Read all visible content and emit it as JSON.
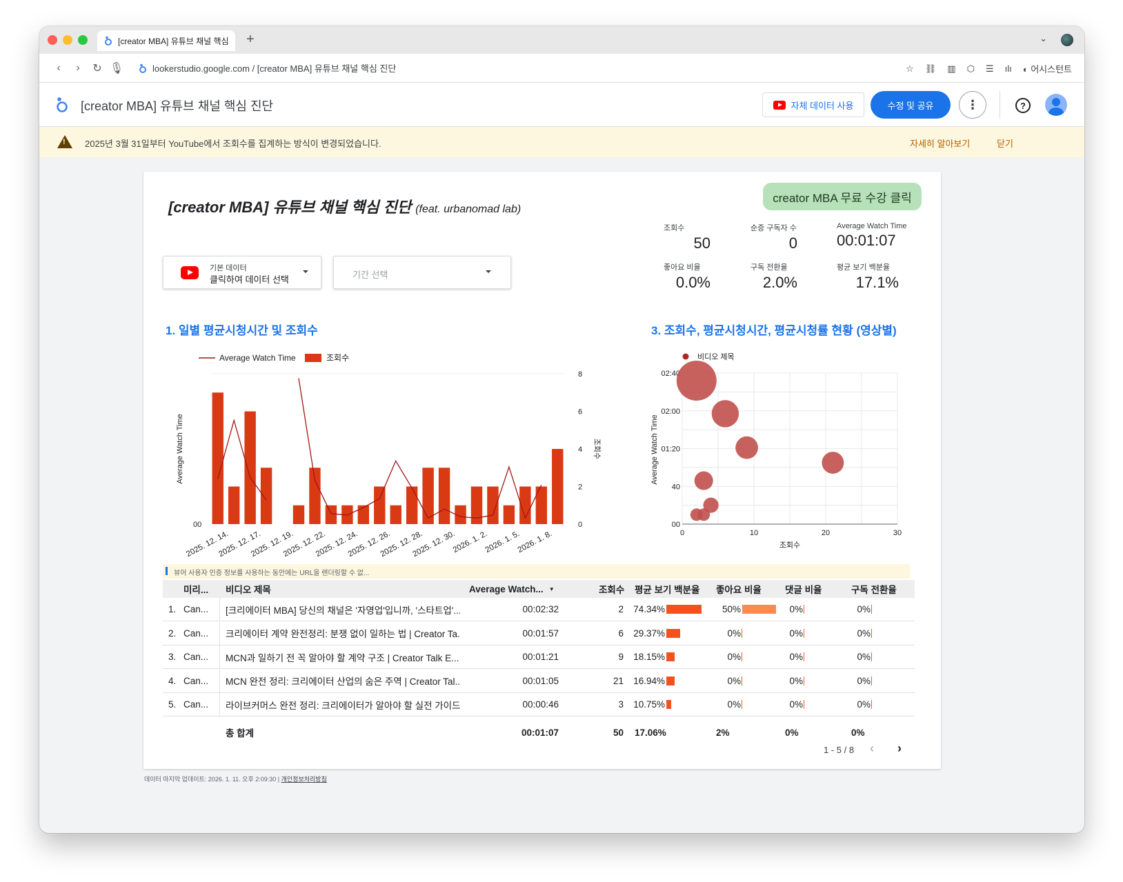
{
  "browser": {
    "tab_title": "[creator MBA] 유튜브 채널 핵심 진단",
    "new_tab": "+",
    "url": "lookerstudio.google.com / [creator MBA] 유튜브 채널 핵심 진단",
    "assistant": "어시스턴트"
  },
  "app": {
    "title": "[creator MBA] 유튜브 채널 핵심 진단",
    "own_data_label": "자체 데이터 사용",
    "edit_share_label": "수정 및 공유"
  },
  "notice": {
    "text": "2025년 3월 31일부터 YouTube에서 조회수를 집계하는 방식이 변경되었습니다.",
    "learn_more": "자세히 알아보기",
    "close": "닫기"
  },
  "report": {
    "title": "[creator MBA] 유튜브 채널 핵심 진단",
    "title_suffix": "(feat. urbanomad lab)",
    "cta": "creator MBA 무료 수강 클릭",
    "kpis": [
      {
        "label": "조회수",
        "value": "50"
      },
      {
        "label": "순증 구독자 수",
        "value": "0"
      },
      {
        "label": "Average Watch Time",
        "value": "00:01:07"
      },
      {
        "label": "좋아요 비율",
        "value": "0.0%"
      },
      {
        "label": "구독 전환율",
        "value": "2.0%"
      },
      {
        "label": "평균 보기 백분율",
        "value": "17.1%"
      }
    ],
    "data_selector": {
      "small": "기본 데이터",
      "main": "클릭하여 데이터 선택"
    },
    "date_selector": {
      "placeholder": "기간 선택"
    },
    "section1_title": "1. 일별 평균시청시간 및 조회수",
    "section3_title": "3. 조회수, 평균시청시간, 평균시청률 현황 (영상별)",
    "viewer_note": "뷰어 사용자 인증 정보를 사용하는 동안에는 URL을 렌더링할 수 없...",
    "pager": "1 - 5 / 8",
    "footer_update": "데이터 마지막 업데이트: 2026. 1. 11. 오후 2:09:30",
    "footer_privacy": "개인정보처리방침"
  },
  "colors": {
    "bar": "#d93a14",
    "line": "#a31515",
    "bubble": "#c0504d",
    "accent": "#1a73e8",
    "table_bar": "#f4511e",
    "table_bar_light": "#ff8a50"
  },
  "chart_data": [
    {
      "type": "bar",
      "combo": "bar+line",
      "title": "1. 일별 평균시청시간 및 조회수",
      "legend": [
        "Average Watch Time",
        "조회수"
      ],
      "legend_position": "top",
      "ylabel_left": "Average Watch Time",
      "ylabel_right": "조회수",
      "left_tick_labels": [
        "00"
      ],
      "right_ticks": [
        0,
        2,
        4,
        6,
        8
      ],
      "ylim_right": [
        0,
        8
      ],
      "x_tick_labels": [
        "2025. 12. 14.",
        "2025. 12. 17.",
        "2025. 12. 19.",
        "2025. 12. 22.",
        "2025. 12. 24.",
        "2025. 12. 26.",
        "2025. 12. 28.",
        "2025. 12. 30.",
        "2026. 1. 2.",
        "2026. 1. 5.",
        "2026. 1. 8."
      ],
      "series": [
        {
          "name": "조회수",
          "values": [
            7,
            2,
            6,
            3,
            0,
            1,
            3,
            1,
            1,
            1,
            2,
            1,
            2,
            3,
            3,
            1,
            2,
            2,
            1,
            2,
            2,
            4
          ]
        },
        {
          "name": "Average Watch Time",
          "values_fraction_of_axis": [
            0.3,
            0.69,
            0.31,
            0.16,
            null,
            0.97,
            0.29,
            0.07,
            0.06,
            0.11,
            0.17,
            0.42,
            0.24,
            0.04,
            0.1,
            0.05,
            0.04,
            0.06,
            0.38,
            0.04,
            0.26
          ]
        }
      ]
    },
    {
      "type": "scatter",
      "title": "3. 조회수, 평균시청시간, 평균시청률 현황 (영상별)",
      "legend": [
        "비디오 제목"
      ],
      "xlabel": "조회수",
      "ylabel": "Average Watch Time",
      "x_ticks": [
        0,
        10,
        20,
        30
      ],
      "y_tick_labels": [
        "00",
        "40",
        "01:20",
        "02:00",
        "02:40"
      ],
      "xlim": [
        0,
        30
      ],
      "ylim_seconds": [
        0,
        160
      ],
      "points": [
        {
          "x": 2,
          "y_seconds": 152,
          "size_pct": 74.34
        },
        {
          "x": 6,
          "y_seconds": 117,
          "size_pct": 29.37
        },
        {
          "x": 9,
          "y_seconds": 81,
          "size_pct": 18.15
        },
        {
          "x": 21,
          "y_seconds": 65,
          "size_pct": 16.94
        },
        {
          "x": 3,
          "y_seconds": 46,
          "size_pct": 10.75
        },
        {
          "x": 4,
          "y_seconds": 20,
          "size_pct": 6.0
        },
        {
          "x": 2,
          "y_seconds": 10,
          "size_pct": 3.0
        },
        {
          "x": 3,
          "y_seconds": 10,
          "size_pct": 3.0
        }
      ]
    }
  ],
  "table": {
    "headers": [
      "미리...",
      "비디오 제목",
      "Average Watch...",
      "조회수",
      "평균 보기 백분율",
      "좋아요 비율",
      "댓글 비율",
      "구독 전환율"
    ],
    "sort_indicator": "▼",
    "rows": [
      {
        "idx": "1.",
        "preview": "Can...",
        "title": "[크리에이터 MBA] 당신의 채널은 '자영업'입니까, '스타트업'...",
        "awt": "00:02:32",
        "views": "2",
        "avp": "74.34%",
        "avp_num": 74.34,
        "like": "50%",
        "like_num": 50,
        "comment": "0%",
        "sub": "0%"
      },
      {
        "idx": "2.",
        "preview": "Can...",
        "title": "크리에이터 계약 완전정리: 분쟁 없이 일하는 법 | Creator Ta...",
        "awt": "00:01:57",
        "views": "6",
        "avp": "29.37%",
        "avp_num": 29.37,
        "like": "0%",
        "like_num": 0,
        "comment": "0%",
        "sub": "0%"
      },
      {
        "idx": "3.",
        "preview": "Can...",
        "title": "MCN과 일하기 전 꼭 알아야 할 계약 구조 | Creator Talk E...",
        "awt": "00:01:21",
        "views": "9",
        "avp": "18.15%",
        "avp_num": 18.15,
        "like": "0%",
        "like_num": 0,
        "comment": "0%",
        "sub": "0%"
      },
      {
        "idx": "4.",
        "preview": "Can...",
        "title": "MCN 완전 정리: 크리에이터 산업의 숨은 주역 | Creator Tal...",
        "awt": "00:01:05",
        "views": "21",
        "avp": "16.94%",
        "avp_num": 16.94,
        "like": "0%",
        "like_num": 0,
        "comment": "0%",
        "sub": "0%"
      },
      {
        "idx": "5.",
        "preview": "Can...",
        "title": "라이브커머스 완전 정리: 크리에이터가 알아야 할 실전 가이드...",
        "awt": "00:00:46",
        "views": "3",
        "avp": "10.75%",
        "avp_num": 10.75,
        "like": "0%",
        "like_num": 0,
        "comment": "0%",
        "sub": "0%"
      }
    ],
    "total": {
      "label": "총 합계",
      "awt": "00:01:07",
      "views": "50",
      "avp": "17.06%",
      "like": "2%",
      "comment": "0%",
      "sub": "0%"
    }
  }
}
